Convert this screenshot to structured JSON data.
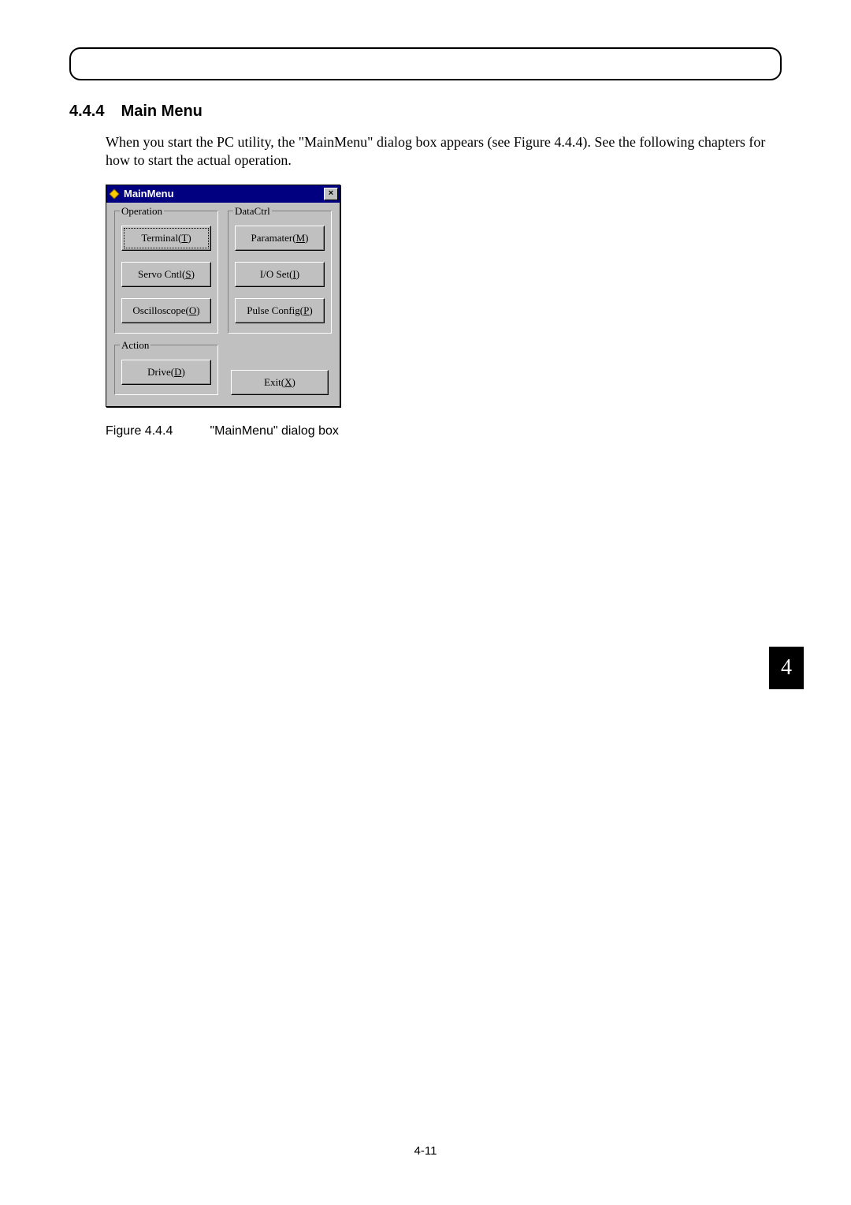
{
  "section": {
    "number": "4.4.4",
    "title": "Main Menu"
  },
  "body_text": "When you start the PC utility, the \"MainMenu\" dialog box appears (see Figure 4.4.4). See the following chapters for how to start the actual operation.",
  "dialog": {
    "title": "MainMenu",
    "close_glyph": "×",
    "groups": {
      "operation": {
        "legend": "Operation",
        "buttons": {
          "terminal": {
            "base": "Terminal(",
            "underline": "T",
            "after": ")"
          },
          "servo": {
            "base": "Servo Cntl(",
            "underline": "S",
            "after": ")"
          },
          "oscope": {
            "base": "Oscilloscope(",
            "underline": "O",
            "after": ")"
          }
        }
      },
      "datactrl": {
        "legend": "DataCtrl",
        "buttons": {
          "param": {
            "base": "Paramater(",
            "underline": "M",
            "after": ")"
          },
          "ioset": {
            "base": "I/O Set(",
            "underline": "I",
            "after": ")"
          },
          "pulse": {
            "base": "Pulse Config(",
            "underline": "P",
            "after": ")"
          }
        }
      },
      "action": {
        "legend": "Action",
        "buttons": {
          "drive": {
            "base": "Drive(",
            "underline": "D",
            "after": ")"
          }
        }
      }
    },
    "exit": {
      "base": "Exit(",
      "underline": "X",
      "after": ")"
    }
  },
  "figure": {
    "number": "Figure 4.4.4",
    "caption": "\"MainMenu\" dialog box"
  },
  "chapter_tab": "4",
  "page_number": "4-11"
}
